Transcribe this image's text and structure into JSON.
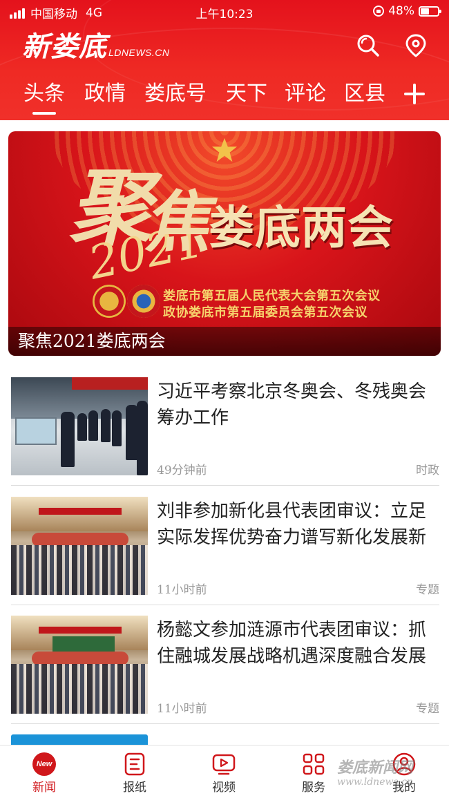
{
  "status_bar": {
    "carrier": "中国移动",
    "network": "4G",
    "time": "上午10:23",
    "battery": "48%"
  },
  "header": {
    "logo_cn": "新娄底",
    "logo_en": "LDNEWS.CN",
    "icons": [
      "search-icon",
      "location-icon"
    ],
    "brand_color": "#e4121c"
  },
  "tabs": [
    {
      "label": "头条",
      "active": true
    },
    {
      "label": "政情",
      "active": false
    },
    {
      "label": "娄底号",
      "active": false
    },
    {
      "label": "天下",
      "active": false
    },
    {
      "label": "评论",
      "active": false
    },
    {
      "label": "区县",
      "active": false
    }
  ],
  "banner": {
    "calligraphy_1": "聚",
    "calligraphy_year": "2021",
    "calligraphy_2": "焦",
    "title": "娄底两会",
    "subtitle_1": "娄底市第五届人民代表大会第五次会议",
    "subtitle_2": "政协娄底市第五届委员会第五次会议",
    "caption": "聚焦2021娄底两会"
  },
  "news": [
    {
      "title": "习近平考察北京冬奥会、冬残奥会筹办工作",
      "time": "49分钟前",
      "category": "时政"
    },
    {
      "title": "刘非参加新化县代表团审议：立足实际发挥优势奋力谱写新化发展新",
      "time": "11小时前",
      "category": "专题"
    },
    {
      "title": "杨懿文参加涟源市代表团审议：抓住融城发展战略机遇深度融合发展",
      "time": "11小时前",
      "category": "专题"
    }
  ],
  "bottom_nav": [
    {
      "label": "新闻",
      "icon": "new-badge-icon",
      "active": true,
      "badge": "New"
    },
    {
      "label": "报纸",
      "icon": "newspaper-icon",
      "active": false
    },
    {
      "label": "视频",
      "icon": "video-icon",
      "active": false
    },
    {
      "label": "服务",
      "icon": "grid-icon",
      "active": false
    },
    {
      "label": "我的",
      "icon": "profile-icon",
      "active": false
    }
  ],
  "watermark": {
    "text": "娄底新闻网",
    "url": "www.ldnews.cn"
  }
}
